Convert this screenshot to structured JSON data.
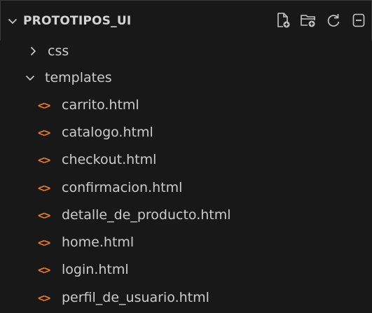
{
  "explorer": {
    "section_title": "PROTOTIPOS_UI",
    "actions": [
      {
        "name": "new-file-icon",
        "tooltip": "New File..."
      },
      {
        "name": "new-folder-icon",
        "tooltip": "New Folder..."
      },
      {
        "name": "refresh-icon",
        "tooltip": "Refresh Explorer"
      },
      {
        "name": "collapse-all-icon",
        "tooltip": "Collapse Folders in Explorer"
      }
    ],
    "folders": [
      {
        "label": "css",
        "expanded": false
      },
      {
        "label": "templates",
        "expanded": true
      }
    ],
    "files": [
      {
        "label": "carrito.html",
        "icon": "html-file-icon"
      },
      {
        "label": "catalogo.html",
        "icon": "html-file-icon"
      },
      {
        "label": "checkout.html",
        "icon": "html-file-icon"
      },
      {
        "label": "confirmacion.html",
        "icon": "html-file-icon"
      },
      {
        "label": "detalle_de_producto.html",
        "icon": "html-file-icon"
      },
      {
        "label": "home.html",
        "icon": "html-file-icon"
      },
      {
        "label": "login.html",
        "icon": "html-file-icon"
      },
      {
        "label": "perfil_de_usuario.html",
        "icon": "html-file-icon"
      }
    ],
    "file_icon_glyph": "<>"
  },
  "colors": {
    "background": "#181818",
    "text": "#cccccc",
    "html_icon": "#e37933",
    "icon": "#c5c5c5"
  }
}
